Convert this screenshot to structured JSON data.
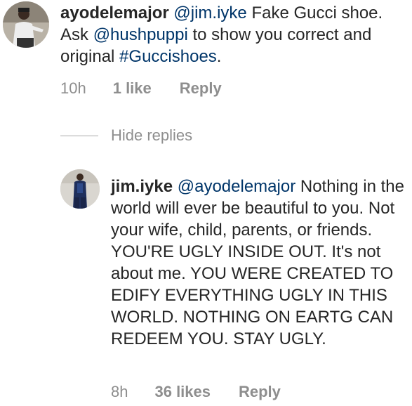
{
  "comments": [
    {
      "username": "ayodelemajor",
      "segments": [
        {
          "type": "mention",
          "text": "@jim.iyke"
        },
        {
          "type": "text",
          "text": " Fake Gucci shoe. Ask "
        },
        {
          "type": "mention",
          "text": "@hushpuppi"
        },
        {
          "type": "text",
          "text": " to show you correct and original "
        },
        {
          "type": "hashtag",
          "text": "#Guccishoes"
        },
        {
          "type": "text",
          "text": "."
        }
      ],
      "time": "10h",
      "likes": "1 like",
      "reply_label": "Reply"
    },
    {
      "username": "jim.iyke",
      "segments": [
        {
          "type": "mention",
          "text": "@ayodelemajor"
        },
        {
          "type": "text",
          "text": " Nothing  in the world will ever be beautiful to you. Not your wife, child, parents, or friends. YOU'RE UGLY INSIDE OUT. It's not about me. YOU WERE CREATED TO EDIFY EVERYTHING UGLY IN THIS WORLD. NOTHING ON EARTG CAN REDEEM YOU. STAY UGLY."
        }
      ],
      "time": "8h",
      "likes": "36 likes",
      "reply_label": "Reply"
    }
  ],
  "hide_replies_label": "Hide replies",
  "colors": {
    "text": "#262626",
    "muted": "#8e8e8e",
    "link": "#003569"
  }
}
